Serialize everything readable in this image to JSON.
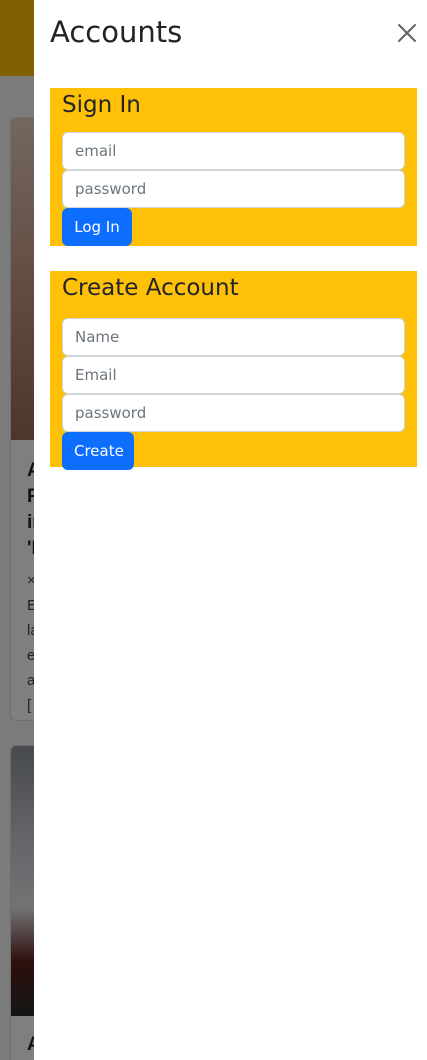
{
  "drawer": {
    "title": "Accounts",
    "close_icon": "close-icon"
  },
  "signin": {
    "heading": "Sign In",
    "email_placeholder": "email",
    "password_placeholder": "password",
    "login_label": "Log In"
  },
  "create_account": {
    "heading": "Create Account",
    "name_placeholder": "Name",
    "email_placeholder": "Email",
    "password_placeholder": "password",
    "create_label": "Create"
  },
  "colors": {
    "panel_background": "#ffc107",
    "primary_button": "#0d6efd",
    "backdrop": "rgba(0,0,0,0.5)"
  }
}
